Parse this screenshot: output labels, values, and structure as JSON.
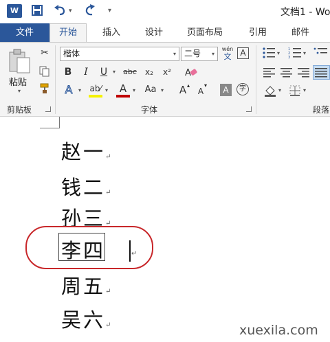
{
  "titlebar": {
    "logo_letter": "W",
    "save_icon": "save-icon",
    "undo_icon": "undo-icon",
    "redo_icon": "redo-icon",
    "customize_icon": "customize-qat-icon",
    "doc_title": "文档1 - Wo"
  },
  "tabs": {
    "file": "文件",
    "home": "开始",
    "insert": "插入",
    "design": "设计",
    "layout": "页面布局",
    "references": "引用",
    "mailings": "邮件"
  },
  "clipboard": {
    "paste_label": "粘贴",
    "group_label": "剪贴板"
  },
  "font": {
    "font_name": "楷体",
    "font_size": "二号",
    "phonetic_top": "wén",
    "phonetic_bottom": "文",
    "char_border": "A",
    "bold": "B",
    "italic": "I",
    "underline": "U",
    "strikethrough": "abc",
    "subscript": "x₂",
    "superscript": "x²",
    "text_effects": "A",
    "highlight": "ab⁄",
    "font_color": "A",
    "change_case": "Aa",
    "grow_font": "A",
    "shrink_font": "A",
    "char_shading": "A",
    "enclose_char": "字",
    "group_label": "字体",
    "highlight_color": "#f4f200",
    "font_color_value": "#c00000"
  },
  "paragraph": {
    "group_label": "段落"
  },
  "document": {
    "lines": [
      "赵一",
      "钱二",
      "孙三",
      "李四",
      "周五",
      "吴六"
    ],
    "paragraph_mark": "↵"
  },
  "watermark": "xuexila.com"
}
